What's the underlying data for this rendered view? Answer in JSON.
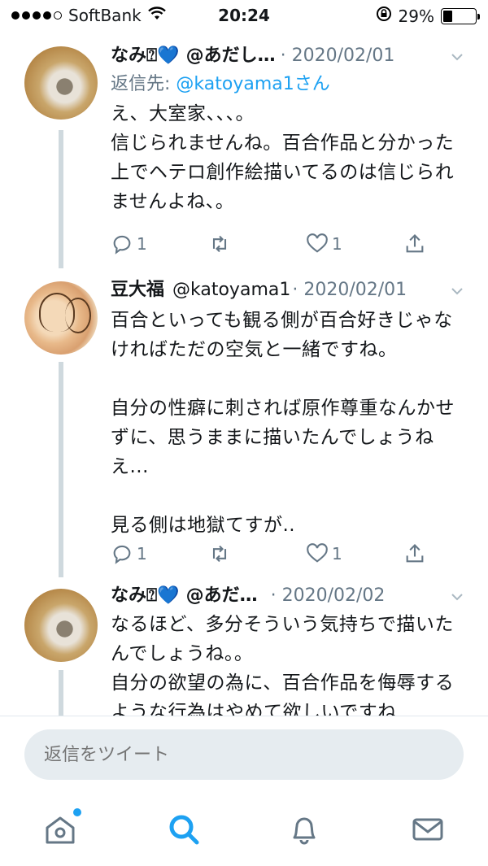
{
  "status_bar": {
    "carrier": "SoftBank",
    "time": "20:24",
    "battery_percent": "29%",
    "battery_level": 0.29,
    "signal_bars": 4
  },
  "tweets": [
    {
      "name": "なみ⍰💙",
      "handle": "@あだし…",
      "date": "· 2020/02/01",
      "reply_to_prefix": "返信先: ",
      "reply_to_user": "@katoyama1さん",
      "text": "え、大室家、、、。\n信じられませんね。百合作品と分かった上でヘテロ創作絵描いてるのは信じられませんよね、。",
      "reply_count": "1",
      "retweet_count": "",
      "like_count": "1"
    },
    {
      "name": "豆大福",
      "handle": "@katoyama1",
      "date": "· 2020/02/01",
      "text": "百合といっても観る側が百合好きじゃなければただの空気と一緒ですね。\n\n自分の性癖に刺されば原作尊重なんかせずに、思うままに描いたんでしょうねえ...\n\n見る側は地獄てすが..",
      "reply_count": "1",
      "retweet_count": "",
      "like_count": "1"
    },
    {
      "name": "なみ⍰💙",
      "handle": "@あだ…",
      "date": "· 2020/02/02",
      "text": "なるほど、多分そういう気持ちで描いたんでしょうね。。\n自分の欲望の為に、百合作品を侮辱するような行為はやめて欲しいですね"
    }
  ],
  "reply_box": {
    "placeholder": "返信をツイート"
  },
  "tab_bar": {
    "icons": [
      "home-icon",
      "search-icon",
      "notifications-icon",
      "messages-icon"
    ],
    "active": "search-icon"
  },
  "colors": {
    "accent": "#1da1f2",
    "secondary_text": "#657786",
    "thread_line": "#cfd9de"
  }
}
